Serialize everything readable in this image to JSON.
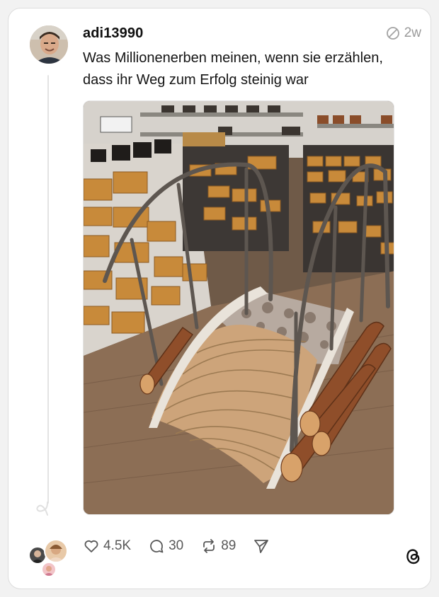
{
  "post": {
    "username": "adi13990",
    "time": "2w",
    "text": "Was Millionenerben meinen, wenn sie erzählen, dass ihr Weg zum Erfolg steinig war"
  },
  "actions": {
    "likes": "4.5K",
    "replies": "30",
    "reposts": "89"
  },
  "icons": {
    "time": "clock-slash-icon",
    "like": "heart-icon",
    "reply": "speech-bubble-icon",
    "repost": "repost-arrows-icon",
    "share": "send-icon",
    "brand": "threads-logo-icon"
  },
  "colors": {
    "text": "#101010",
    "muted": "#9a9a9a",
    "action": "#585858",
    "border": "#dcdcdc"
  }
}
